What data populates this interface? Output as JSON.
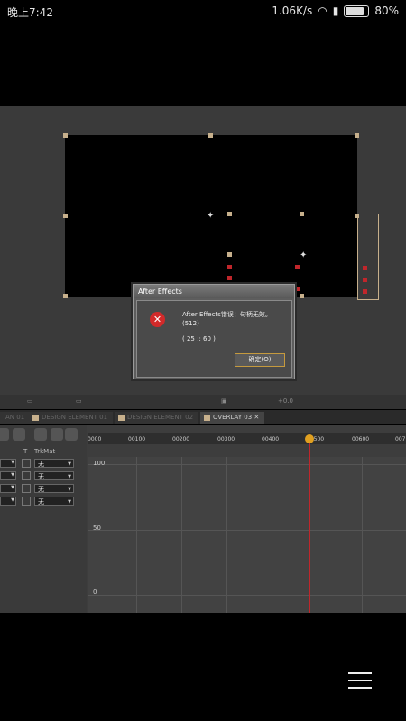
{
  "status_bar": {
    "time": "晚上7:42",
    "speed": "1.06K/s",
    "battery": "80%",
    "battery_level": 0.8
  },
  "dialog": {
    "title": "After Effects",
    "message_line1": "After Effects错误：句柄无效。",
    "message_line2": "(512)",
    "code": "( 25 :: 60 )",
    "ok_label": "确定(O)"
  },
  "tabs": [
    {
      "label": "AN 01",
      "active": false
    },
    {
      "label": "DESIGN ELEMENT 01",
      "active": false
    },
    {
      "label": "DESIGN ELEMENT 02",
      "active": false
    },
    {
      "label": "OVERLAY 03",
      "active": true
    }
  ],
  "timeline": {
    "ticks": [
      "0000",
      "00100",
      "00200",
      "00300",
      "00400",
      "00500",
      "00600",
      "007"
    ],
    "column_header_t": "T",
    "column_header_trkmat": "TrkMat",
    "rows": [
      {
        "trkmat": "无"
      },
      {
        "trkmat": "无"
      },
      {
        "trkmat": "无"
      },
      {
        "trkmat": "无"
      }
    ],
    "y_labels": [
      "100",
      "50",
      "0"
    ],
    "toolbar_text": "+0.0"
  },
  "colors": {
    "accent_handle": "#c7b08c",
    "error_red": "#d22a2a",
    "playhead": "#c0262b",
    "ok_border": "#c59a3e"
  }
}
